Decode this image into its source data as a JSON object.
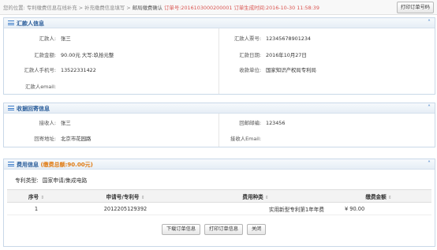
{
  "breadcrumb": {
    "prefix": "您的位置:",
    "items": [
      "专利缴费信息在线补充",
      "补充缴费信息填写"
    ],
    "current": "邮局缴费确认",
    "order_no_label": "订单号:",
    "order_no": "2016103000200001",
    "order_time_label": "订单生成时间:",
    "order_time": "2016-10-30 11:58:39",
    "sep": ">"
  },
  "print_order_button": "打印订单号码",
  "remitter": {
    "title": "汇款人信息",
    "name_label": "汇款人:",
    "name": "张三",
    "receipt_label": "汇款人票号:",
    "receipt": "12345678901234",
    "amount_label": "汇款金额:",
    "amount": "90.00元 大写:玖拾元整",
    "date_label": "汇款日期:",
    "date": "2016年10月27日",
    "phone_label": "汇款人手机号:",
    "phone": "13522331422",
    "payee_label": "收款单位:",
    "payee": "国家知识产权局专利局",
    "email_label": "汇款人email:",
    "email": ""
  },
  "receipt_info": {
    "title": "收据回寄信息",
    "name_label": "接收人:",
    "name": "张三",
    "zip_label": "回邮邮编:",
    "zip": "123456",
    "address_label": "回寄地址:",
    "address": "北京市花园路",
    "email_label": "接收人Email:",
    "email": ""
  },
  "fees": {
    "title": "费用信息",
    "total_text": "(缴费总额:90.00元)",
    "patent_type_label": "专利类型:",
    "patent_type": "国家申请/集成电路",
    "columns": [
      "序号",
      "申请号/专利号",
      "费用种类",
      "缴费金额"
    ],
    "rows": [
      {
        "no": "1",
        "app_no": "2012205129392",
        "fee_type": "实用新型专利第1年年费",
        "amount": "¥ 90.00"
      }
    ]
  },
  "buttons": {
    "download": "下载订单信息",
    "print": "打印订单信息",
    "close": "关闭"
  },
  "colors": {
    "accent": "#2a5d9a",
    "order": "#d9534f",
    "total": "#e07a10"
  }
}
